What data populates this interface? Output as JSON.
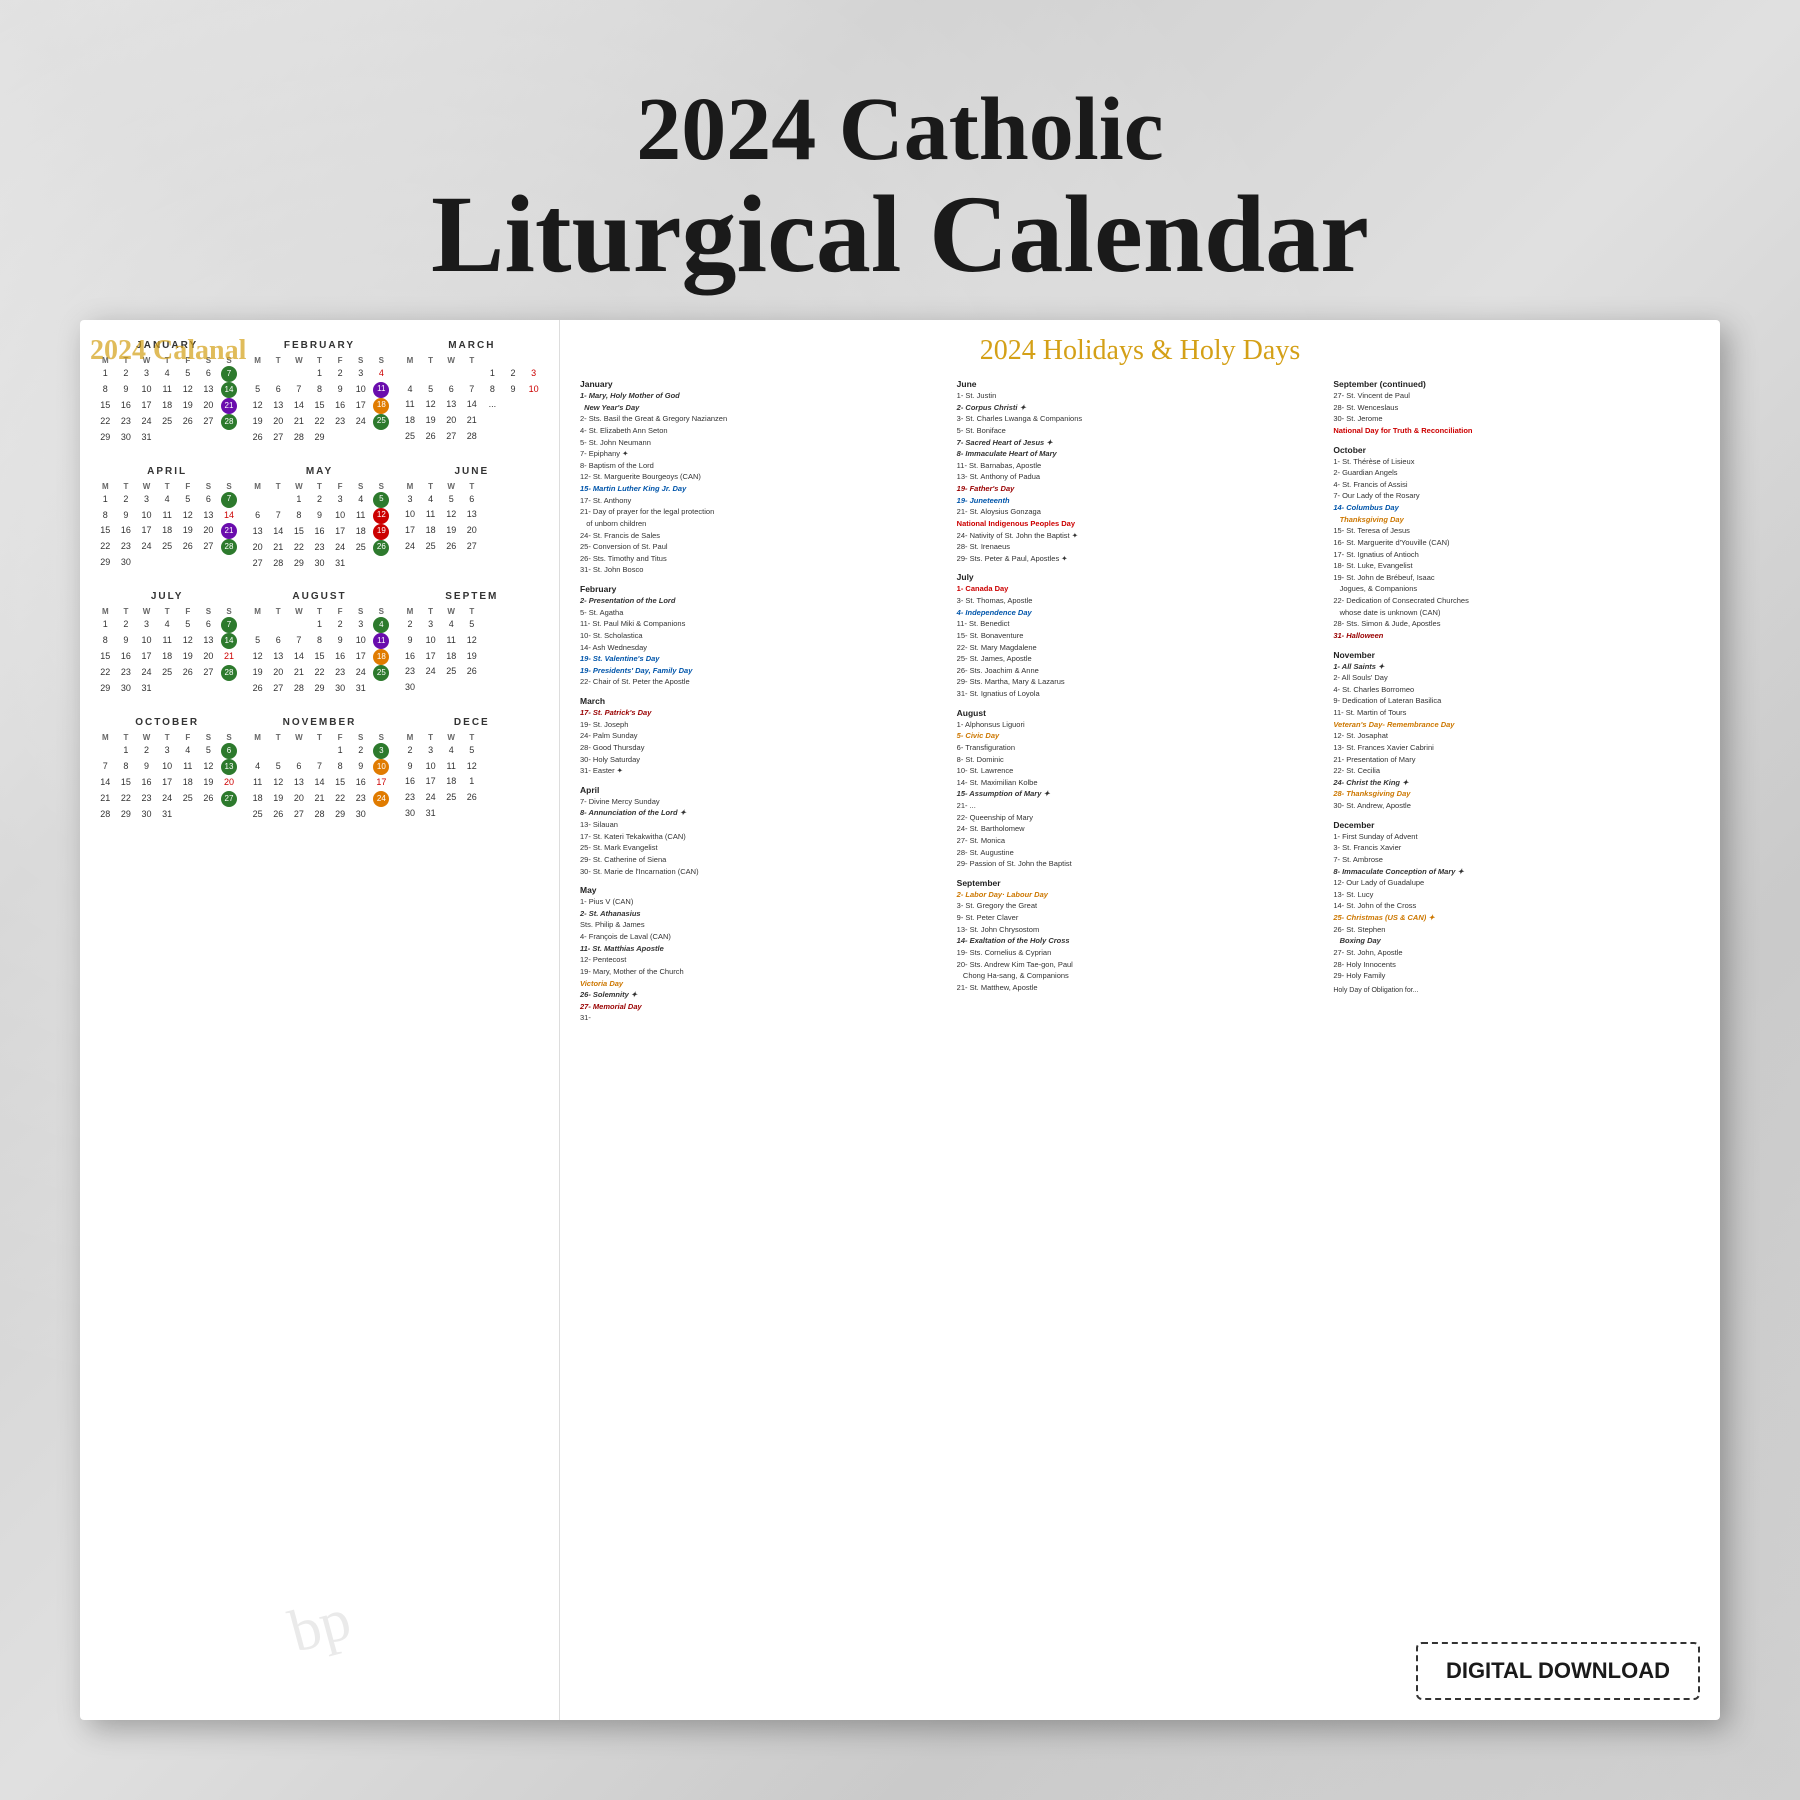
{
  "title": {
    "line1": "2024 Catholic",
    "line2": "Liturgical Calendar"
  },
  "calendar_overlay": "2024 Calanal",
  "holidays_title": "2024 Holidays & Holy Days",
  "digital_download": "DIGITAL DOWNLOAD",
  "watermark": "bp",
  "months": {
    "january": "JANUARY",
    "february": "FEBRUARY",
    "march": "MARCH",
    "april": "APRIL",
    "may": "MAY",
    "june": "JUNE",
    "july": "JULY",
    "august": "AUGUST",
    "september": "SEPTEMBER",
    "october": "OCTOBER",
    "november": "NOVEMBER",
    "december": "DECEMBER"
  },
  "days_header": [
    "M",
    "T",
    "W",
    "T",
    "F",
    "S",
    "S"
  ]
}
